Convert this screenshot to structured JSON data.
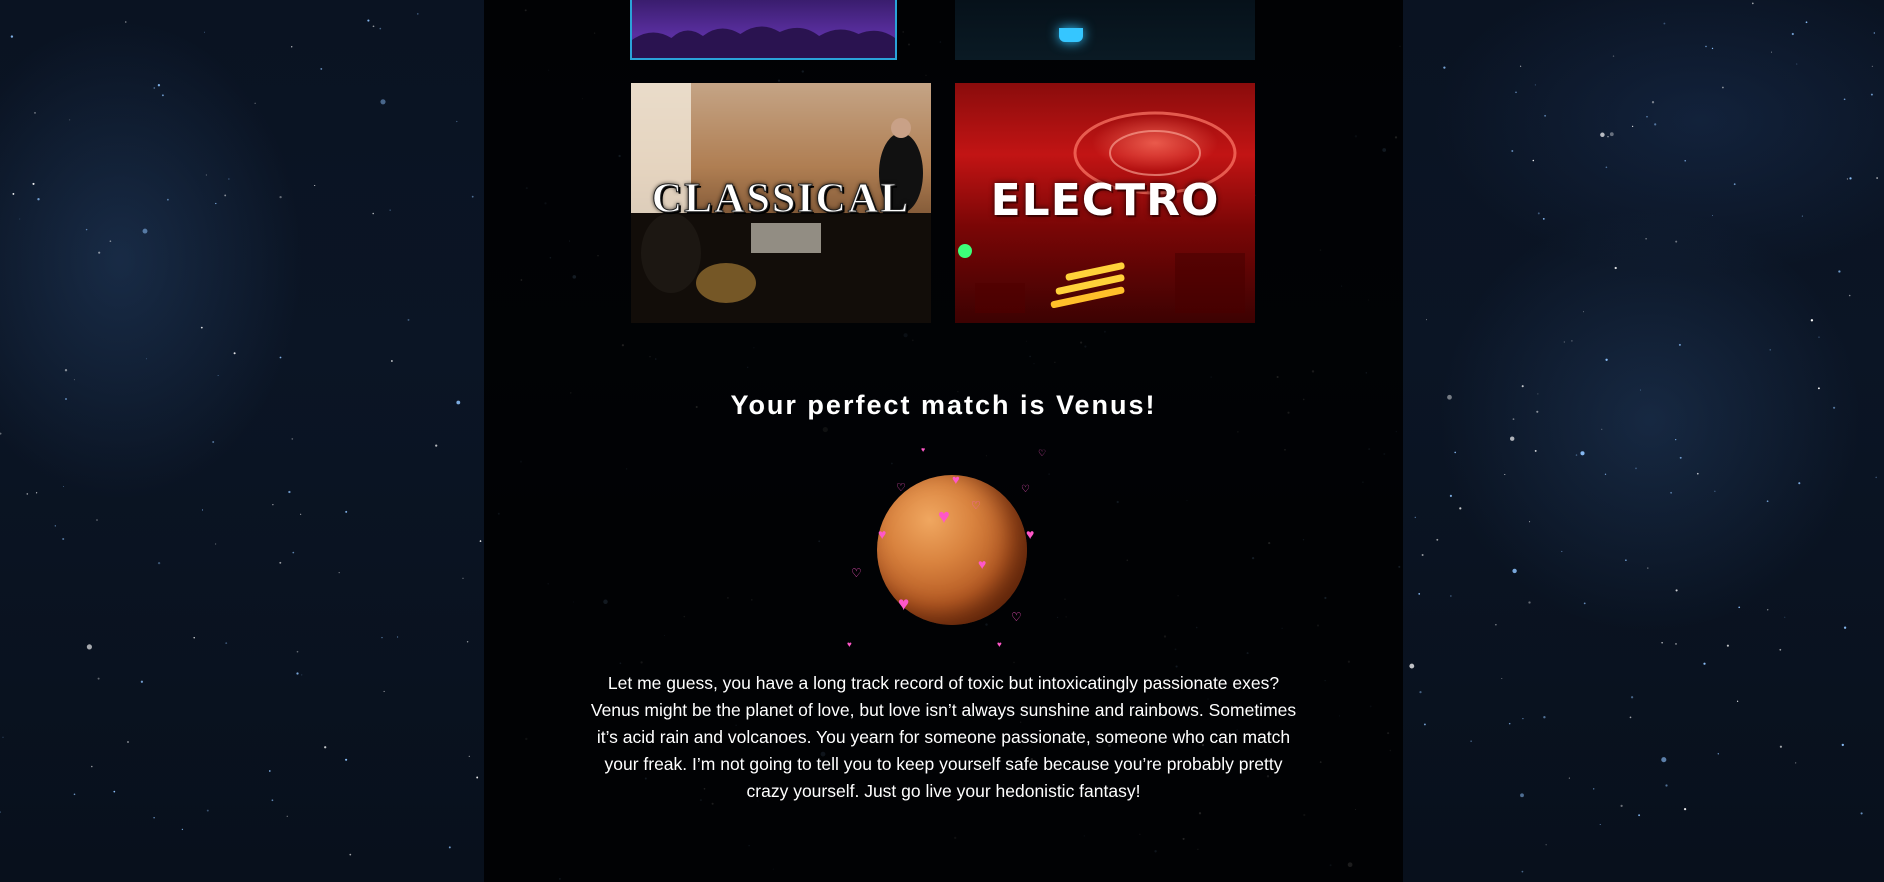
{
  "genres": {
    "classical": {
      "label": "CLASSICAL"
    },
    "electro": {
      "label": "ELECTRO"
    }
  },
  "result": {
    "title": "Your perfect match is Venus!",
    "planet": "Venus",
    "description": "Let me guess, you have a long track record of toxic but intoxicatingly passionate exes? Venus might be the planet of love, but love isn’t always sunshine and rainbows. Sometimes it’s acid rain and volcanoes. You yearn for someone passionate, someone who can match your freak. I’m not going to tell you to keep yourself safe because you’re probably pretty crazy yourself. Just go live your hedonistic fantasy!"
  },
  "colors": {
    "selected_border": "#2aa3d8",
    "heart": "#ff57c8"
  }
}
